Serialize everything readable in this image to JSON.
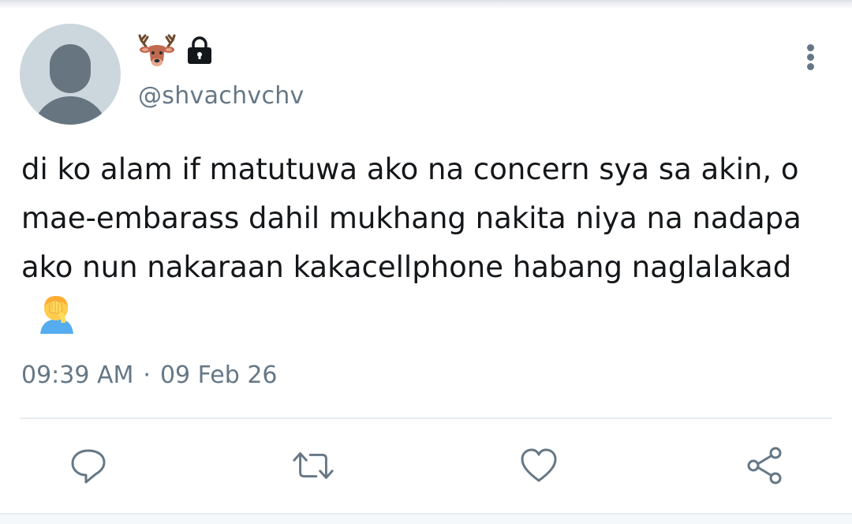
{
  "tweet": {
    "handle": "@shvachvchv",
    "text": "di ko alam if matutuwa ako na concern sya sa akin, o mae-embarass dahil mukhang nakita niya na nadapa ako nun nakaraan kakacellphone habang naglalakad",
    "time": "09:39 AM",
    "separator": "·",
    "date": "09 Feb 26",
    "name_emoji_icon": "deer-icon",
    "protected_icon": "lock-icon",
    "text_emoji_icon": "facepalm-icon"
  },
  "actions": [
    {
      "name": "reply",
      "icon": "reply-icon"
    },
    {
      "name": "retweet",
      "icon": "retweet-icon"
    },
    {
      "name": "like",
      "icon": "heart-icon"
    },
    {
      "name": "share",
      "icon": "share-icon"
    }
  ],
  "colors": {
    "secondary_text": "#657786",
    "primary_text": "#14171a",
    "avatar_bg": "#ccd6dd",
    "avatar_fg": "#66757f",
    "divider": "#e6ecf0"
  }
}
